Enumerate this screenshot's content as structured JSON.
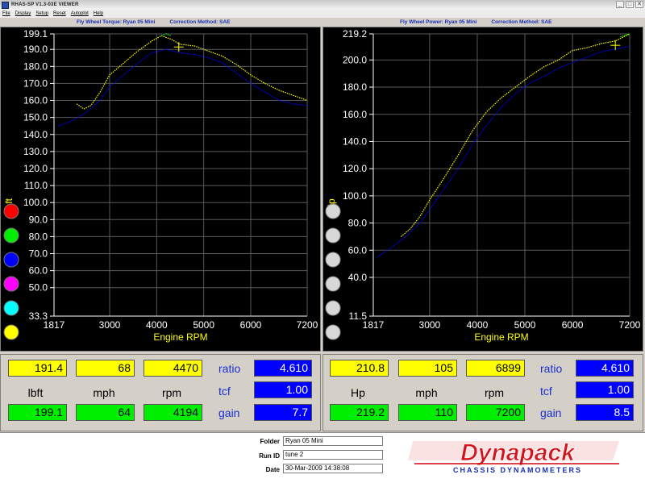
{
  "window": {
    "title": "RHAS-SP V1.3-03E VIEWER",
    "buttons": [
      "_",
      "□",
      "✕"
    ]
  },
  "menu": [
    "File",
    "Display",
    "Setup",
    "Reset",
    "Autoplot",
    "Help"
  ],
  "left_chart": {
    "title": "Fly Wheel Torque: Ryan 05 Mini",
    "method": "Correction Method: SAE",
    "ylabel": "lbft",
    "xlabel": "Engine RPM",
    "colors": [
      "#ff0000",
      "#00ee00",
      "#0000ff",
      "#ff00ff",
      "#00ffff",
      "#ffff00"
    ]
  },
  "right_chart": {
    "title": "Fly Wheel Power: Ryan 05 Mini",
    "method": "Correction Method: SAE",
    "ylabel": "Hp",
    "xlabel": "Engine RPM"
  },
  "chart_data": [
    {
      "type": "line",
      "title": "Fly Wheel Torque: Ryan 05 Mini",
      "xlabel": "Engine RPM",
      "ylabel": "lbft",
      "xlim": [
        1817,
        7200
      ],
      "ylim": [
        33.3,
        199.1
      ],
      "xticks": [
        "1817",
        "3000",
        "4000",
        "5000",
        "6000",
        "7200"
      ],
      "yticks": [
        "33.3",
        "50.0",
        "60.0",
        "70.0",
        "80.0",
        "90.0",
        "100.0",
        "110.0",
        "120.0",
        "130.0",
        "140.0",
        "150.0",
        "160.0",
        "170.0",
        "180.0",
        "190.0",
        "199.1"
      ],
      "grid": true,
      "cursor": {
        "x": 4470,
        "y": 191.4
      },
      "series": [
        {
          "color": "#ffff00",
          "x": [
            2300,
            2450,
            2600,
            2800,
            3000,
            3300,
            3600,
            3900,
            4100,
            4300,
            4500,
            4800,
            5100,
            5400,
            5700,
            6000,
            6300,
            6600,
            6900,
            7200
          ],
          "values": [
            158,
            155,
            157,
            165,
            175,
            182,
            189,
            195,
            198,
            196,
            193,
            192,
            189,
            186,
            181,
            175,
            170,
            166,
            163,
            160
          ]
        },
        {
          "color": "#0000ff",
          "x": [
            1900,
            2200,
            2500,
            2800,
            3000,
            3300,
            3600,
            3900,
            4194,
            4500,
            4800,
            5100,
            5400,
            5700,
            6000,
            6300,
            6600,
            6900,
            7200
          ],
          "values": [
            145,
            148,
            153,
            160,
            168,
            175,
            182,
            188,
            190,
            188,
            187,
            185,
            182,
            176,
            170,
            165,
            160,
            158,
            157
          ]
        },
        {
          "color": "#00ee00",
          "x": [
            4100,
            4194,
            4300
          ],
          "values": [
            198,
            199.1,
            198
          ]
        }
      ]
    },
    {
      "type": "line",
      "title": "Fly Wheel Power: Ryan 05 Mini",
      "xlabel": "Engine RPM",
      "ylabel": "Hp",
      "xlim": [
        1817,
        7200
      ],
      "ylim": [
        11.5,
        219.2
      ],
      "xticks": [
        "1817",
        "3000",
        "4000",
        "5000",
        "6000",
        "7200"
      ],
      "yticks": [
        "11.5",
        "40.0",
        "60.0",
        "80.0",
        "100.0",
        "120.0",
        "140.0",
        "160.0",
        "180.0",
        "200.0",
        "219.2"
      ],
      "grid": true,
      "cursor": {
        "x": 6899,
        "y": 210.8
      },
      "series": [
        {
          "color": "#ffff00",
          "x": [
            2400,
            2600,
            2800,
            3000,
            3300,
            3600,
            3900,
            4200,
            4500,
            4800,
            5100,
            5400,
            5700,
            6000,
            6300,
            6600,
            6899,
            7200
          ],
          "values": [
            70,
            76,
            85,
            97,
            113,
            130,
            148,
            162,
            172,
            180,
            188,
            195,
            200,
            207,
            209,
            212,
            214,
            219.2
          ]
        },
        {
          "color": "#0000ff",
          "x": [
            1900,
            2200,
            2500,
            2800,
            3000,
            3300,
            3600,
            3900,
            4200,
            4500,
            4800,
            5100,
            5400,
            5700,
            6000,
            6300,
            6600,
            6900,
            7200
          ],
          "values": [
            55,
            62,
            70,
            80,
            90,
            105,
            120,
            138,
            152,
            165,
            175,
            183,
            188,
            194,
            198,
            202,
            206,
            208,
            210
          ]
        },
        {
          "color": "#00ee00",
          "x": [
            7000,
            7200
          ],
          "values": [
            217,
            219.2
          ]
        }
      ]
    }
  ],
  "left_readout": {
    "row1": [
      "191.4",
      "68",
      "4470"
    ],
    "units": [
      "lbft",
      "mph",
      "rpm"
    ],
    "row2": [
      "199.1",
      "64",
      "4194"
    ],
    "labels": [
      "ratio",
      "tcf",
      "gain"
    ],
    "values": [
      "4.610",
      "1.00",
      "7.7"
    ]
  },
  "right_readout": {
    "row1": [
      "210.8",
      "105",
      "6899"
    ],
    "units": [
      "Hp",
      "mph",
      "rpm"
    ],
    "row2": [
      "219.2",
      "110",
      "7200"
    ],
    "labels": [
      "ratio",
      "tcf",
      "gain"
    ],
    "values": [
      "4.610",
      "1.00",
      "8.5"
    ]
  },
  "info": {
    "folder_label": "Folder",
    "folder": "Ryan 05 Mini",
    "runid_label": "Run ID",
    "runid": "tune 2",
    "date_label": "Date",
    "date": "30-Mar-2009  14:38:08"
  },
  "logo": {
    "brand": "Dynapack",
    "tagline": "CHASSIS DYNAMOMETERS",
    "brand_color": "#d4141c",
    "tagline_color": "#1a2fb5"
  }
}
